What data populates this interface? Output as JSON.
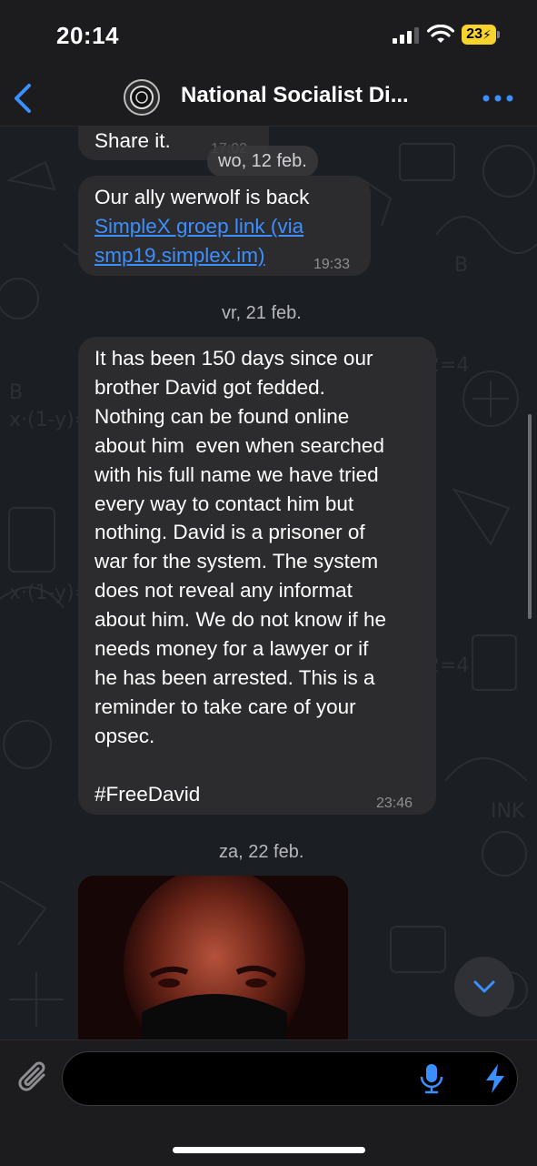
{
  "status_bar": {
    "time": "20:14",
    "battery": "23"
  },
  "header": {
    "title": "National Socialist Di..."
  },
  "messages": {
    "m1": {
      "text": "Share it.",
      "time": "17:02"
    },
    "date1": "wo, 12 feb.",
    "m2": {
      "line1": "Our ally werwolf is back",
      "link_line1": "SimpleX groep link (via",
      "link_line2": "smp19.simplex.im)",
      "time": "19:33"
    },
    "date2": "vr, 21 feb.",
    "m3": {
      "lines": [
        "It has been 150 days since our",
        "brother David got fedded.",
        "Nothing can be found online",
        "about him  even when searched",
        "with his full name we have tried",
        "every way to contact him but",
        "nothing. David is a prisoner of",
        "war for the system. The system",
        "does not reveal any informat",
        "about him. We do not know if he",
        "needs money for a lawyer or if",
        "he has been arrested. This is a",
        "reminder to take care of your",
        "opsec."
      ],
      "hashtag": "#FreeDavid",
      "time": "23:46"
    },
    "date3": "za, 22 feb."
  },
  "composer": {
    "placeholder": ""
  },
  "colors": {
    "accent": "#3b8fff",
    "bubble": "#2c2c2e",
    "battery": "#f6d32d"
  }
}
